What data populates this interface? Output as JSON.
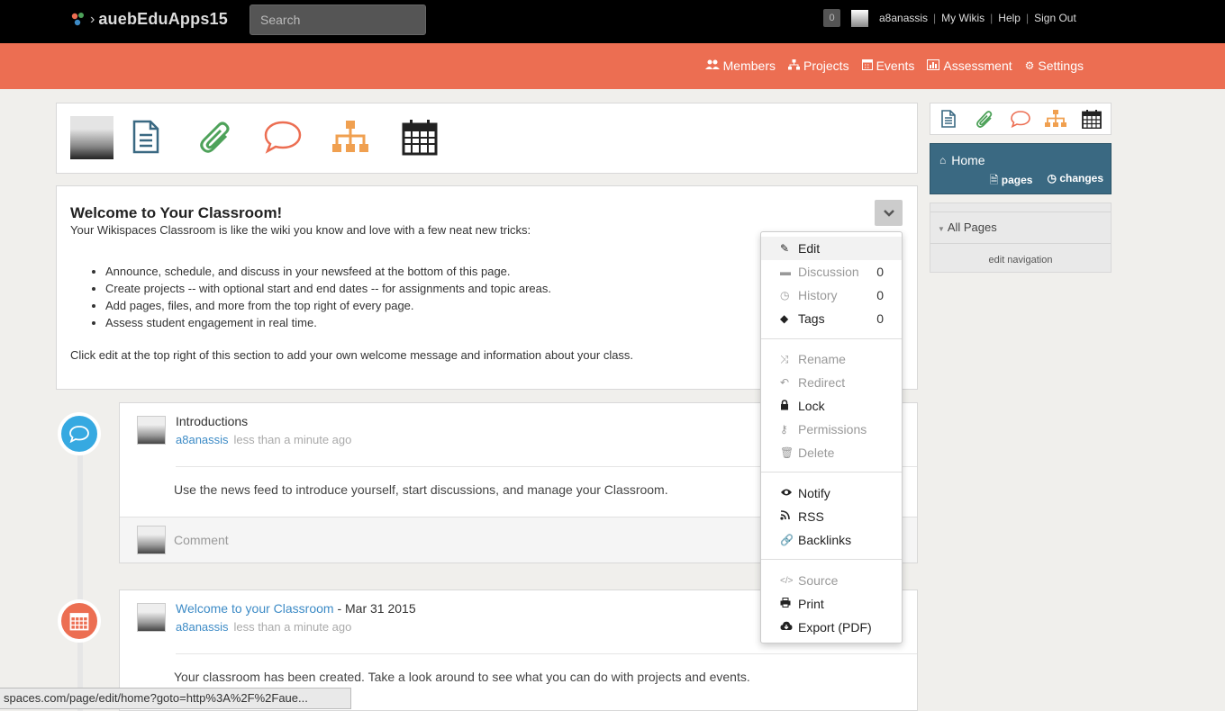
{
  "topbar": {
    "brand": "auebEduApps15",
    "search_placeholder": "Search",
    "notifications": "0",
    "username": "a8anassis",
    "links": [
      "My Wikis",
      "Help",
      "Sign Out"
    ]
  },
  "nav": [
    {
      "icon": "members-icon",
      "label": "Members"
    },
    {
      "icon": "projects-icon",
      "label": "Projects"
    },
    {
      "icon": "events-icon",
      "label": "Events"
    },
    {
      "icon": "assessment-icon",
      "label": "Assessment"
    },
    {
      "icon": "settings-icon",
      "label": "Settings"
    }
  ],
  "welcome": {
    "title": "Welcome to Your Classroom!",
    "intro": "Your Wikispaces Classroom is like the wiki you know and love with a few neat new tricks:",
    "bullets": [
      "Announce, schedule, and discuss in your newsfeed at the bottom of this page.",
      "Create projects -- with optional start and end dates -- for assignments and topic areas.",
      "Add pages, files, and more from the top right of every page.",
      "Assess student engagement in real time."
    ],
    "outro": "Click edit at the top right of this section to add your own welcome message and information about your class."
  },
  "feed": [
    {
      "title": "Introductions",
      "user": "a8anassis",
      "time": "less than a minute ago",
      "body": "Use the news feed to introduce yourself, start discussions, and manage your Classroom.",
      "comment_placeholder": "Comment"
    },
    {
      "title_link": "Welcome to your Classroom",
      "title_suffix": " - Mar 31 2015",
      "user": "a8anassis",
      "time": "less than a minute ago",
      "body": "Your classroom has been created. Take a look around to see what you can do with projects and events."
    }
  ],
  "sidebar": {
    "home": "Home",
    "pages": "pages",
    "changes": "changes",
    "all_pages": "All Pages",
    "edit_navigation": "edit navigation"
  },
  "menu": {
    "edit": "Edit",
    "discussion": "Discussion",
    "discussion_count": "0",
    "history": "History",
    "history_count": "0",
    "tags": "Tags",
    "tags_count": "0",
    "rename": "Rename",
    "redirect": "Redirect",
    "lock": "Lock",
    "permissions": "Permissions",
    "delete": "Delete",
    "notify": "Notify",
    "rss": "RSS",
    "backlinks": "Backlinks",
    "source": "Source",
    "print": "Print",
    "export": "Export (PDF)"
  },
  "statusbar": "spaces.com/page/edit/home?goto=http%3A%2F%2Faue...",
  "colors": {
    "orange": "#ec6e52",
    "blue_accent": "#3a6982",
    "link": "#3d8bc6",
    "icon_blue": "#3a6982",
    "icon_green": "#4ea25a",
    "icon_orange": "#ec6e52",
    "icon_amber": "#f0a050"
  }
}
